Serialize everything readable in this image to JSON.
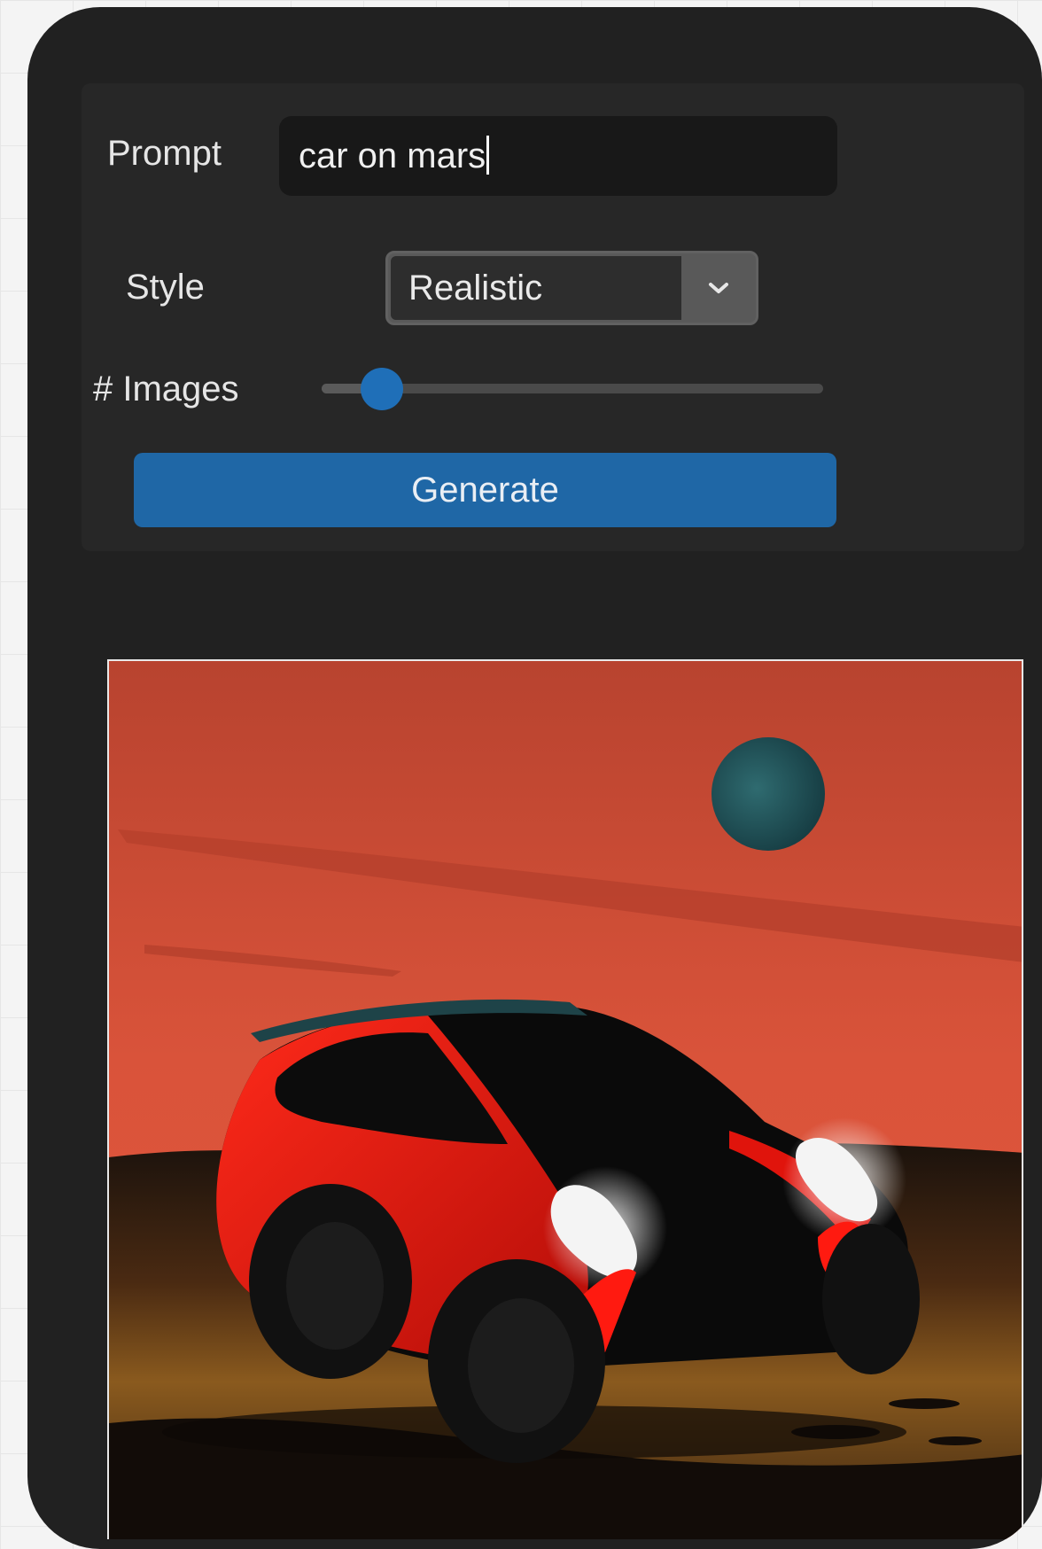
{
  "form": {
    "prompt_label": "Prompt",
    "prompt_value": "car on mars",
    "style_label": "Style",
    "style_value": "Realistic",
    "images_label": "# Images",
    "images_slider_fraction": 0.12,
    "generate_label": "Generate"
  },
  "icons": {
    "style_dropdown": "chevron-down-icon"
  },
  "colors": {
    "accent": "#1f67a6",
    "panel": "#212121",
    "card": "#272727"
  }
}
